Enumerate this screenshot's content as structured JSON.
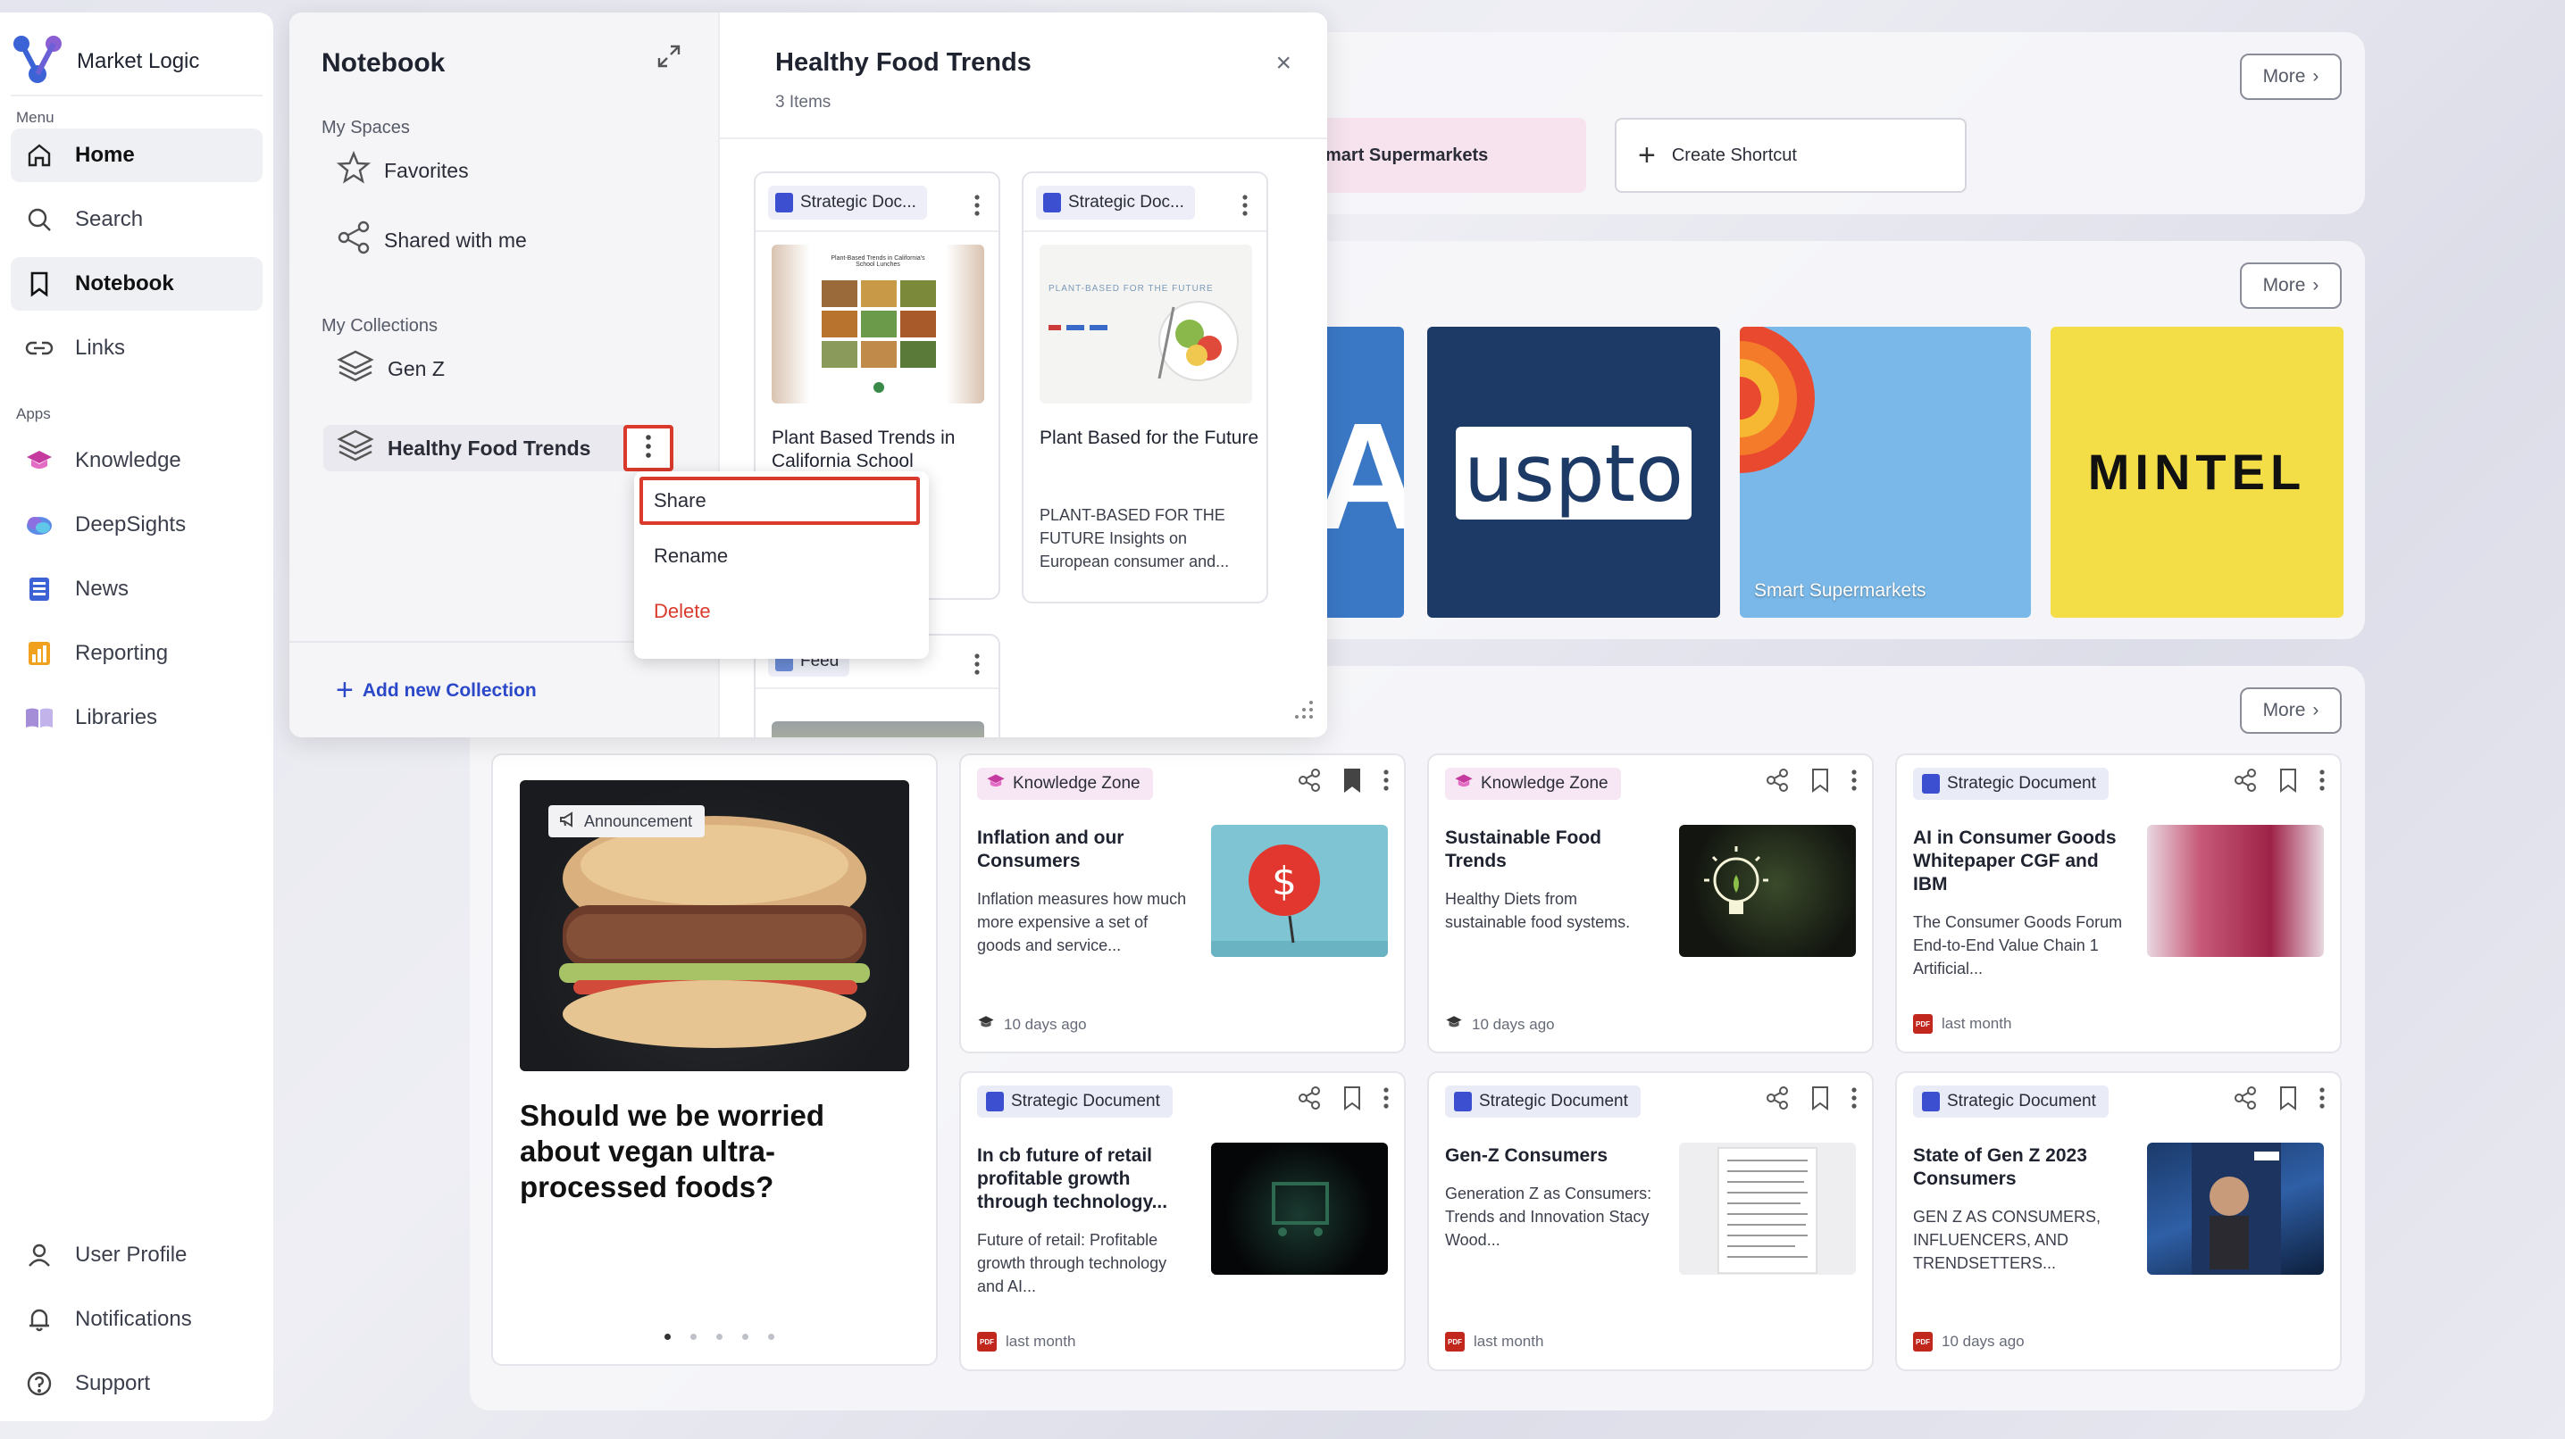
{
  "brand": {
    "name": "Market Logic"
  },
  "sidebar": {
    "menu_label": "Menu",
    "apps_label": "Apps",
    "items": [
      {
        "label": "Home",
        "icon": "home-icon"
      },
      {
        "label": "Search",
        "icon": "search-icon"
      },
      {
        "label": "Notebook",
        "icon": "bookmark-icon"
      },
      {
        "label": "Links",
        "icon": "link-icon"
      }
    ],
    "apps": [
      {
        "label": "Knowledge",
        "icon": "knowledge-icon",
        "color": "#c43a9e"
      },
      {
        "label": "DeepSights",
        "icon": "deepsights-icon",
        "color": "#4a6fd6"
      },
      {
        "label": "News",
        "icon": "news-icon",
        "color": "#3b63d6"
      },
      {
        "label": "Reporting",
        "icon": "reporting-icon",
        "color": "#f0a11e"
      },
      {
        "label": "Libraries",
        "icon": "libraries-icon",
        "color": "#a48ed8"
      }
    ],
    "bottom": [
      {
        "label": "User Profile",
        "icon": "user-icon"
      },
      {
        "label": "Notifications",
        "icon": "bell-icon"
      },
      {
        "label": "Support",
        "icon": "help-icon"
      }
    ]
  },
  "shortcuts": {
    "more_label": "More",
    "partial_label": "mart Supermarkets",
    "create_label": "Create Shortcut"
  },
  "sources": {
    "more_label": "More",
    "tiles": [
      {
        "label": "A",
        "color": "#3a78c6"
      },
      {
        "label": "uspto",
        "color": "#1d3a66"
      },
      {
        "label": "Smart Supermarkets",
        "color": "#79b8e8"
      },
      {
        "label": "MINTEL",
        "color": "#f4de48"
      }
    ]
  },
  "feed": {
    "more_label": "More",
    "announcement": {
      "tag": "Announcement",
      "title": "Should we be worried about vegan ultra-processed foods?",
      "pages": 5,
      "active_page": 1
    },
    "cards": [
      {
        "tag": "Knowledge Zone",
        "tag_type": "kz",
        "title": "Inflation and our Consumers",
        "desc": "Inflation measures how much more expensive a set of goods and service...",
        "foot": "10 days ago",
        "foot_type": "kz",
        "bookmarked": true
      },
      {
        "tag": "Knowledge Zone",
        "tag_type": "kz",
        "title": "Sustainable Food Trends",
        "desc": "Healthy Diets from sustainable food systems.",
        "foot": "10 days ago",
        "foot_type": "kz",
        "bookmarked": false
      },
      {
        "tag": "Strategic Document",
        "tag_type": "sd",
        "title": "AI in Consumer Goods Whitepaper CGF and IBM",
        "desc": "The Consumer Goods Forum End-to-End Value Chain 1 Artificial...",
        "foot": "last month",
        "foot_type": "pdf",
        "bookmarked": false
      },
      {
        "tag": "Strategic Document",
        "tag_type": "sd",
        "title": "In cb future of retail profitable growth through technology...",
        "desc": "Future of retail: Profitable growth through technology and AI...",
        "foot": "last month",
        "foot_type": "pdf",
        "bookmarked": false
      },
      {
        "tag": "Strategic Document",
        "tag_type": "sd",
        "title": "Gen-Z Consumers",
        "desc": "Generation Z as Consumers: Trends and Innovation Stacy Wood...",
        "foot": "last month",
        "foot_type": "pdf",
        "bookmarked": false
      },
      {
        "tag": "Strategic Document",
        "tag_type": "sd",
        "title": "State of Gen Z 2023 Consumers",
        "desc": "GEN Z AS CONSUMERS, INFLUENCERS, AND TRENDSETTERS...",
        "foot": "10 days ago",
        "foot_type": "pdf",
        "bookmarked": false
      }
    ]
  },
  "notebook": {
    "title": "Notebook",
    "my_spaces_label": "My Spaces",
    "favorites_label": "Favorites",
    "shared_label": "Shared with me",
    "my_collections_label": "My Collections",
    "collections": [
      {
        "label": "Gen Z"
      },
      {
        "label": "Healthy Food Trends"
      }
    ],
    "add_collection_label": "Add new Collection",
    "context_menu": {
      "share": "Share",
      "rename": "Rename",
      "delete": "Delete"
    },
    "collection_view": {
      "title": "Healthy Food Trends",
      "count": "3 Items",
      "docs": [
        {
          "tag": "Strategic Doc...",
          "title": "Plant Based Trends in California School",
          "desc": "n",
          "desc2": "..."
        },
        {
          "tag": "Strategic Doc...",
          "title": "Plant Based for the Future",
          "desc": "PLANT-BASED FOR THE FUTURE Insights on European consumer and..."
        },
        {
          "tag": "Feed"
        }
      ],
      "thumb1_text": "Plant-Based Trends in California's School Lunches",
      "thumb2_text": "PLANT-BASED FOR THE FUTURE"
    }
  },
  "colors": {
    "accent": "#2b48c8",
    "danger": "#d93a2b",
    "pdf": "#c2271e"
  }
}
